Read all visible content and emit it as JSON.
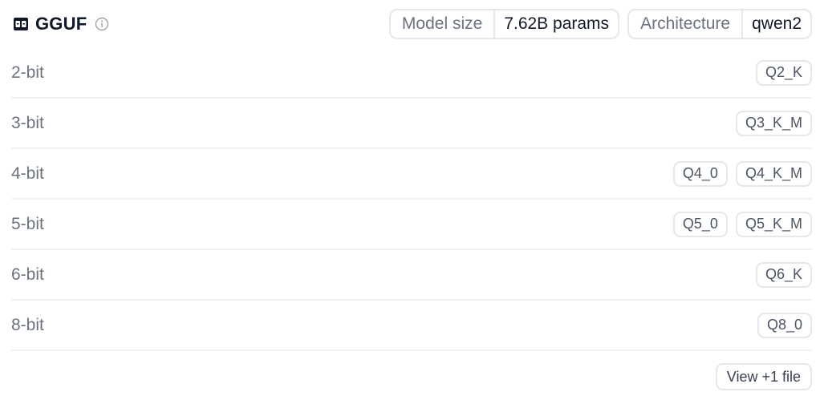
{
  "header": {
    "title": "GGUF",
    "title_icon": "gguf-file-icon",
    "info_icon": "info-icon",
    "meta": [
      {
        "label": "Model size",
        "value": "7.62B params"
      },
      {
        "label": "Architecture",
        "value": "qwen2"
      }
    ]
  },
  "rows": [
    {
      "label": "2-bit",
      "quants": [
        "Q2_K"
      ]
    },
    {
      "label": "3-bit",
      "quants": [
        "Q3_K_M"
      ]
    },
    {
      "label": "4-bit",
      "quants": [
        "Q4_0",
        "Q4_K_M"
      ]
    },
    {
      "label": "5-bit",
      "quants": [
        "Q5_0",
        "Q5_K_M"
      ]
    },
    {
      "label": "6-bit",
      "quants": [
        "Q6_K"
      ]
    },
    {
      "label": "8-bit",
      "quants": [
        "Q8_0"
      ]
    }
  ],
  "footer": {
    "view_more_label": "View +1 file"
  },
  "colors": {
    "border": "#e5e7eb",
    "muted_text": "#6b7280",
    "text": "#111827"
  }
}
